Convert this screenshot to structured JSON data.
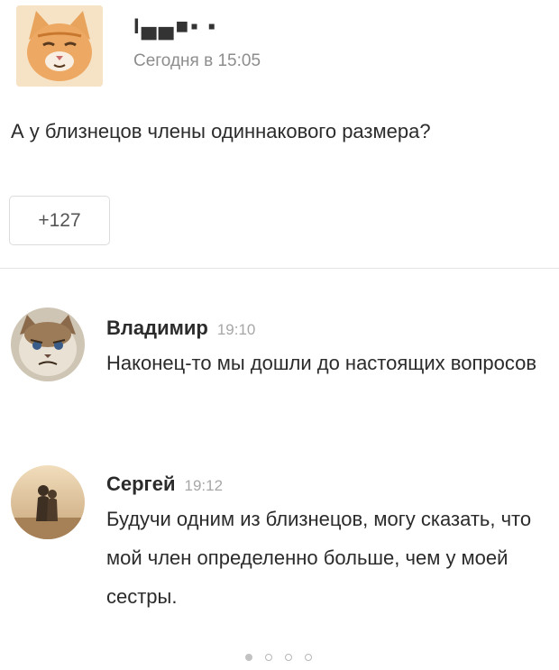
{
  "post": {
    "author": "I▄▄■▪ ▪",
    "time": "Сегодня в 15:05",
    "text": "А у близнецов члены одиннакового размера?",
    "likes_label": "+127"
  },
  "comments": [
    {
      "author": "Владимир",
      "time": "19:10",
      "text": "Наконец-то мы дошли до настоящих вопросов",
      "avatar": "grumpy-cat-avatar"
    },
    {
      "author": "Сергей",
      "time": "19:12",
      "text": "Будучи одним из близнецов, могу сказать, что мой член определенно больше, чем у моей сестры.",
      "avatar": "couple-photo-avatar"
    }
  ],
  "pagination": {
    "total": 4,
    "active": 1
  },
  "colors": {
    "text": "#2b2b2b",
    "muted": "#8d8d8d",
    "border": "#dcdcdc"
  }
}
